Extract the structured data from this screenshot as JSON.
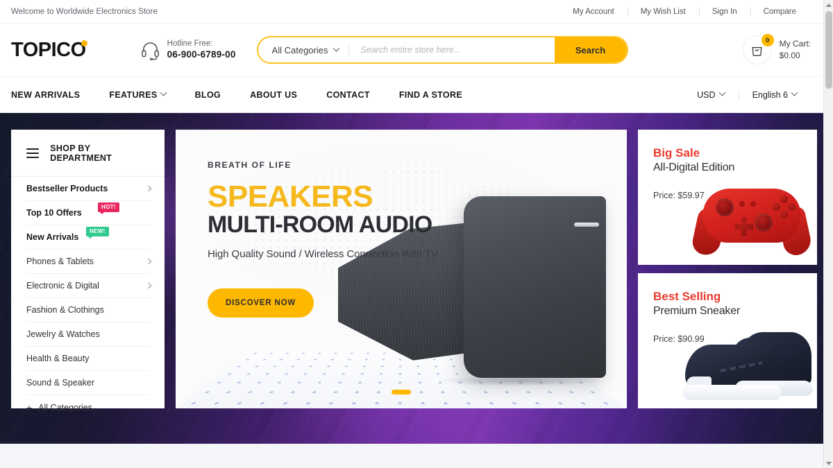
{
  "topbar": {
    "welcome": "Welcome to Worldwide Electronics Store",
    "links": [
      {
        "label": "My Account"
      },
      {
        "label": "My Wish List"
      },
      {
        "label": "Sign In"
      },
      {
        "label": "Compare"
      }
    ]
  },
  "header": {
    "logo": "TOPICO",
    "hotline_label": "Hotline Free:",
    "hotline_number": "06-900-6789-00",
    "search": {
      "category": "All Categories",
      "placeholder": "Search entire store here...",
      "value": "",
      "button": "Search"
    },
    "cart": {
      "count": "0",
      "label": "My Cart:",
      "total": "$0.00"
    }
  },
  "nav": {
    "items": [
      {
        "label": "NEW ARRIVALS",
        "has_caret": false
      },
      {
        "label": "FEATURES",
        "has_caret": true
      },
      {
        "label": "BLOG",
        "has_caret": false
      },
      {
        "label": "ABOUT US",
        "has_caret": false
      },
      {
        "label": "CONTACT",
        "has_caret": false
      },
      {
        "label": "FIND A STORE",
        "has_caret": false
      }
    ],
    "currency": "USD",
    "language": "English 6"
  },
  "sidebar": {
    "title": "SHOP BY DEPARTMENT",
    "items": [
      {
        "label": "Bestseller Products",
        "bold": true,
        "arrow": true,
        "badge": null
      },
      {
        "label": "Top 10 Offers",
        "bold": true,
        "arrow": false,
        "badge": "HOT!",
        "badge_type": "hot"
      },
      {
        "label": "New Arrivals",
        "bold": true,
        "arrow": false,
        "badge": "NEW!",
        "badge_type": "new"
      },
      {
        "label": "Phones & Tablets",
        "bold": false,
        "arrow": true,
        "badge": null
      },
      {
        "label": "Electronic & Digital",
        "bold": false,
        "arrow": true,
        "badge": null
      },
      {
        "label": "Fashion & Clothings",
        "bold": false,
        "arrow": false,
        "badge": null
      },
      {
        "label": "Jewelry & Watches",
        "bold": false,
        "arrow": false,
        "badge": null
      },
      {
        "label": "Health & Beauty",
        "bold": false,
        "arrow": false,
        "badge": null
      },
      {
        "label": "Sound & Speaker",
        "bold": false,
        "arrow": false,
        "badge": null
      },
      {
        "label": "All Categories",
        "bold": false,
        "arrow": false,
        "badge": null,
        "plus": true
      }
    ]
  },
  "hero": {
    "eyebrow": "BREATH OF LIFE",
    "title_highlight": "SPEAKERS",
    "title_main": "MULTI-ROOM AUDIO",
    "subtitle": "High Quality Sound / Wireless Connection With TV",
    "cta": "DISCOVER NOW"
  },
  "promos": [
    {
      "title": "Big Sale",
      "subtitle": "All-Digital Edition",
      "price": "Price: $59.97",
      "art": "game-controller"
    },
    {
      "title": "Best Selling",
      "subtitle": "Premium Sneaker",
      "price": "Price: $90.99",
      "art": "sneaker"
    }
  ],
  "colors": {
    "accent_yellow": "#ffb800",
    "promo_red": "#ea3a2d",
    "badge_hot": "#e8285f",
    "badge_new": "#2ec98d",
    "hero_purple": "#6c2e9e"
  }
}
